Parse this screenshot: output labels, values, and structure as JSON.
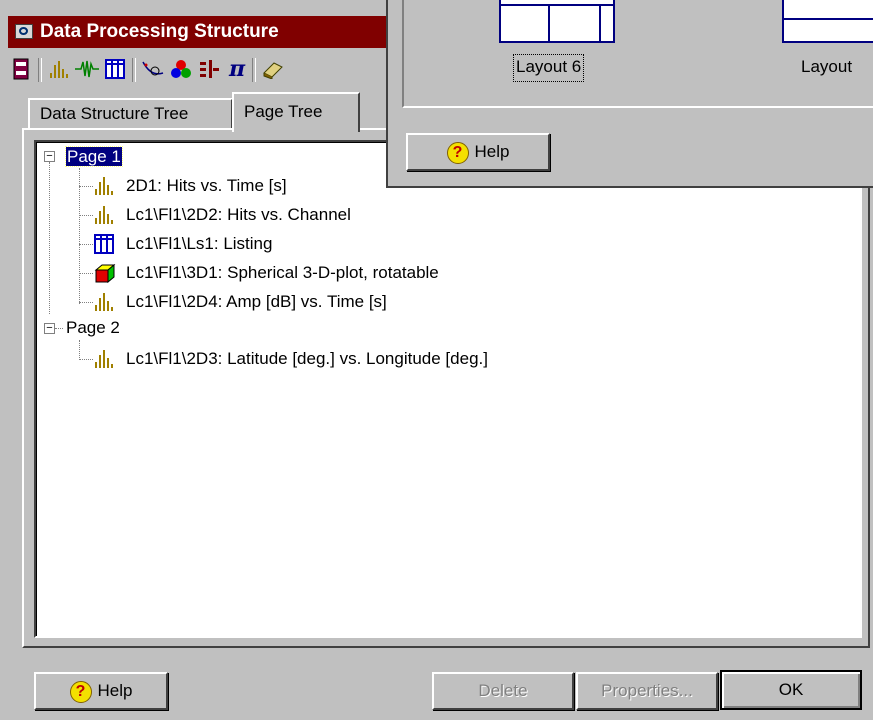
{
  "window": {
    "title": "Data Processing Structure"
  },
  "toolbar": {
    "icons": [
      "page-book-icon",
      "histogram-icon",
      "waveform-icon",
      "listing-icon",
      "curve-fit-icon",
      "color-dots-icon",
      "filter-bars-icon",
      "pi-icon",
      "book-icon"
    ],
    "pi_symbol": "π"
  },
  "tabs": {
    "data_structure_tree": "Data Structure Tree",
    "page_tree": "Page Tree"
  },
  "tree": {
    "pages": [
      {
        "label": "Page 1",
        "expanded": true,
        "selected": true,
        "children": [
          {
            "icon": "histogram-icon",
            "label": "2D1: Hits  vs. Time [s]"
          },
          {
            "icon": "histogram-icon",
            "label": "Lc1\\Fl1\\2D2: Hits  vs. Channel"
          },
          {
            "icon": "listing-icon",
            "label": "Lc1\\Fl1\\Ls1: Listing"
          },
          {
            "icon": "cube-3d-icon",
            "label": "Lc1\\Fl1\\3D1: Spherical 3-D-plot, rotatable"
          },
          {
            "icon": "histogram-icon",
            "label": "Lc1\\Fl1\\2D4: Amp [dB] vs. Time [s]"
          }
        ]
      },
      {
        "label": "Page 2",
        "expanded": true,
        "selected": false,
        "children": [
          {
            "icon": "histogram-icon",
            "label": "Lc1\\Fl1\\2D3: Latitude [deg.] vs. Longitude [deg.]"
          }
        ]
      }
    ]
  },
  "buttons": {
    "help": "Help",
    "delete": "Delete",
    "properties": "Properties...",
    "ok": "OK"
  },
  "layout_dialog": {
    "layout6_label": "Layout 6",
    "layout7_label": "Layout",
    "help": "Help"
  }
}
